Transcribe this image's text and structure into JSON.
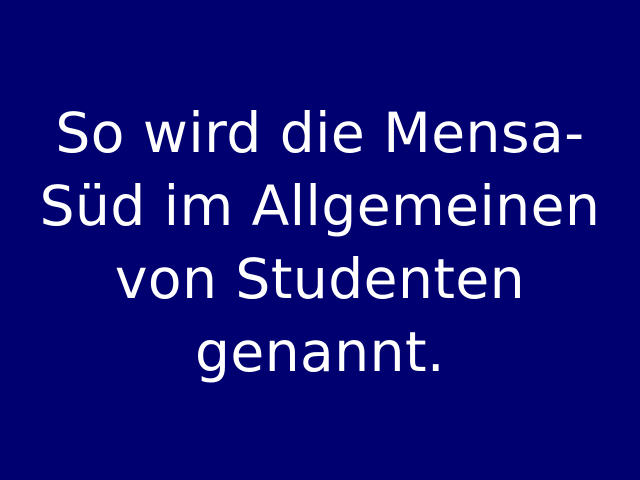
{
  "slide": {
    "background_color": "#000070",
    "text_color": "#ffffff",
    "lines": [
      "So wird die Mensa-",
      "Süd im Allgemeinen",
      "von Studenten",
      "genannt."
    ]
  }
}
